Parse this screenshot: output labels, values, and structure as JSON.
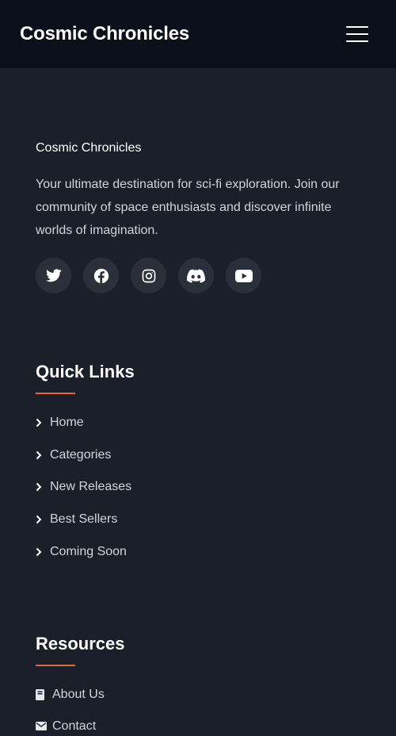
{
  "header": {
    "brand": "Cosmic Chronicles",
    "menu_icon": "hamburger-menu-icon"
  },
  "about": {
    "title": "Cosmic Chronicles",
    "description": "Your ultimate destination for sci-fi exploration. Join our community of space enthusiasts and discover infinite worlds of imagination."
  },
  "socials": [
    {
      "icon": "twitter-icon"
    },
    {
      "icon": "facebook-icon"
    },
    {
      "icon": "instagram-icon"
    },
    {
      "icon": "discord-icon"
    },
    {
      "icon": "youtube-icon"
    }
  ],
  "quick_links": {
    "title": "Quick Links",
    "items": [
      {
        "label": "Home"
      },
      {
        "label": "Categories"
      },
      {
        "label": "New Releases"
      },
      {
        "label": "Best Sellers"
      },
      {
        "label": "Coming Soon"
      }
    ]
  },
  "resources": {
    "title": "Resources",
    "items": [
      {
        "label": "About Us",
        "icon": "book-icon"
      },
      {
        "label": "Contact",
        "icon": "envelope-icon"
      }
    ]
  },
  "colors": {
    "accent": "#e8683b",
    "background": "#1b1f29",
    "header_background": "#0b0f19"
  }
}
